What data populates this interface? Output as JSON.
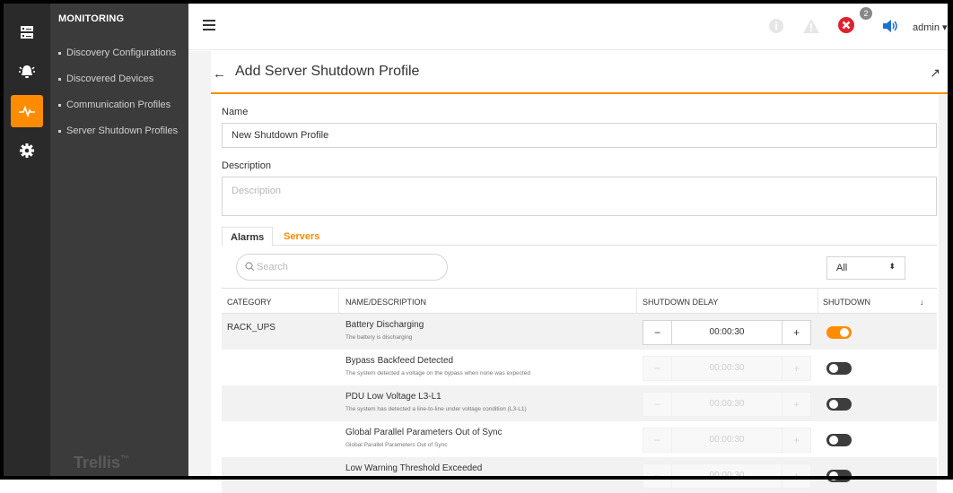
{
  "menu": {
    "title": "MONITORING",
    "items": [
      {
        "label": "Discovery Configurations"
      },
      {
        "label": "Discovered Devices"
      },
      {
        "label": "Communication Profiles"
      },
      {
        "label": "Server Shutdown Profiles"
      }
    ],
    "brand": "Trellis",
    "brand_mark": "™"
  },
  "topbar": {
    "notification_count": "2",
    "user": "admin",
    "user_caret": "▾"
  },
  "page": {
    "back": "←",
    "title": "Add Server Shutdown Profile",
    "expand": "↗"
  },
  "form": {
    "name_label": "Name",
    "name_value": "New Shutdown Profile",
    "description_label": "Description",
    "description_placeholder": "Description"
  },
  "tabs": [
    {
      "label": "Alarms",
      "active": true
    },
    {
      "label": "Servers",
      "active": false
    }
  ],
  "search": {
    "placeholder": "Search"
  },
  "filter": {
    "value": "All",
    "arrow": "⬍"
  },
  "table": {
    "headers": {
      "category": "CATEGORY",
      "name": "NAME/DESCRIPTION",
      "delay": "SHUTDOWN DELAY",
      "shutdown": "SHUTDOWN",
      "sort": "↓"
    },
    "rows": [
      {
        "category": "RACK_UPS",
        "name": "Battery Discharging",
        "description": "The battery is discharging",
        "delay": "00:00:30",
        "enabled": true
      },
      {
        "category": "",
        "name": "Bypass Backfeed Detected",
        "description": "The system detected a voltage on the bypass when none was expected",
        "delay": "00:00:30",
        "enabled": false
      },
      {
        "category": "",
        "name": "PDU Low Voltage L3-L1",
        "description": "The system has detected a line-to-line under voltage condition (L3-L1)",
        "delay": "00:00:30",
        "enabled": false
      },
      {
        "category": "",
        "name": "Global Parallel Parameters Out of Sync",
        "description": "Global Parallel Parameters Out of Sync",
        "delay": "00:00:30",
        "enabled": false
      },
      {
        "category": "",
        "name": "Low Warning Threshold Exceeded",
        "description": "",
        "delay": "00:00:30",
        "enabled": false
      }
    ],
    "minus": "−",
    "plus": "+"
  },
  "colors": {
    "accent": "#ff8c00",
    "sidebar": "#3b3b3b",
    "rail": "#2a2a2a",
    "alarm": "#e0202e",
    "speaker": "#1d6fd1"
  }
}
